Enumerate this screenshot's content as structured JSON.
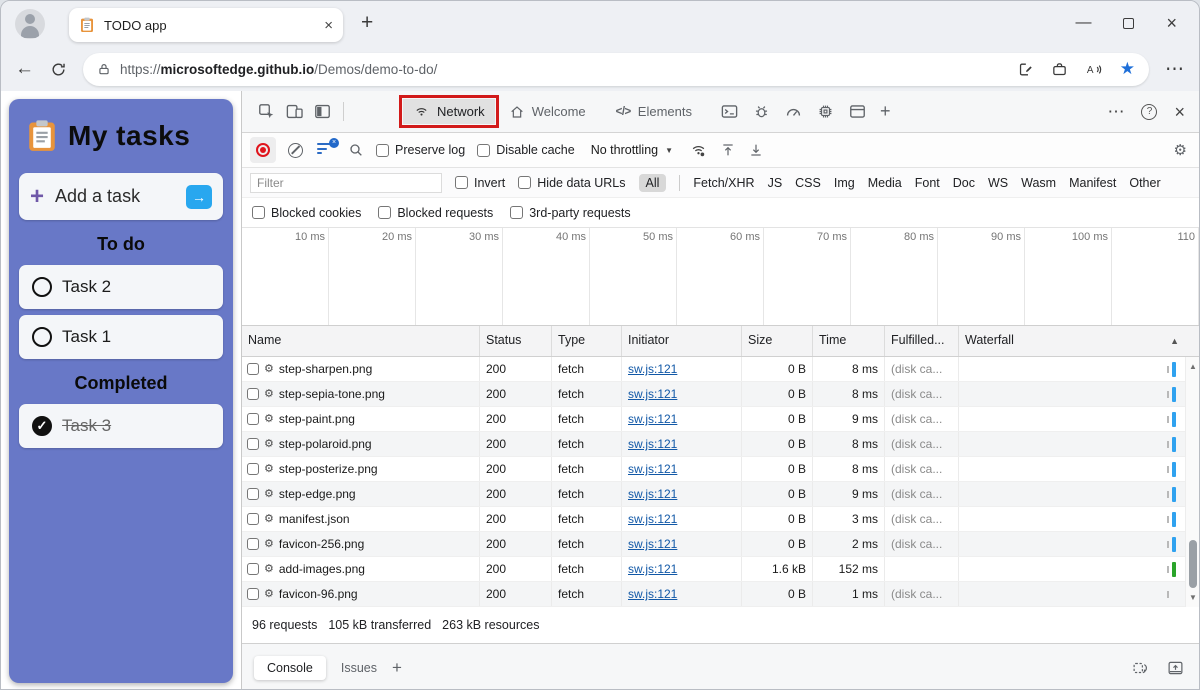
{
  "browser": {
    "tab_title": "TODO app",
    "url_scheme": "https://",
    "url_host": "microsoftedge.github.io",
    "url_path": "/Demos/demo-to-do/"
  },
  "todo": {
    "title": "My tasks",
    "add_label": "Add a task",
    "sections": [
      {
        "heading": "To do",
        "tasks": [
          {
            "label": "Task 2",
            "done": false
          },
          {
            "label": "Task 1",
            "done": false
          }
        ]
      },
      {
        "heading": "Completed",
        "tasks": [
          {
            "label": "Task 3",
            "done": true
          }
        ]
      }
    ]
  },
  "devtools": {
    "tabs": [
      {
        "label": "Network",
        "icon": "wifi-icon",
        "active": true,
        "highlighted": true
      },
      {
        "label": "Welcome",
        "icon": "home-icon",
        "active": false
      },
      {
        "label": "Elements",
        "icon": "code-icon",
        "active": false
      }
    ],
    "network_toolbar": {
      "preserve_log": "Preserve log",
      "disable_cache": "Disable cache",
      "throttling": "No throttling"
    },
    "filter_bar": {
      "placeholder": "Filter",
      "invert": "Invert",
      "hide_data_urls": "Hide data URLs",
      "selected_type": "All",
      "types": [
        "All",
        "Fetch/XHR",
        "JS",
        "CSS",
        "Img",
        "Media",
        "Font",
        "Doc",
        "WS",
        "Wasm",
        "Manifest",
        "Other"
      ]
    },
    "blocked_bar": [
      "Blocked cookies",
      "Blocked requests",
      "3rd-party requests"
    ],
    "timeline_labels": [
      "10 ms",
      "20 ms",
      "30 ms",
      "40 ms",
      "50 ms",
      "60 ms",
      "70 ms",
      "80 ms",
      "90 ms",
      "100 ms",
      "110"
    ],
    "table": {
      "columns": [
        "Name",
        "Status",
        "Type",
        "Initiator",
        "Size",
        "Time",
        "Fulfilled...",
        "Waterfall"
      ],
      "rows": [
        {
          "name": "step-sharpen.png",
          "status": "200",
          "type": "fetch",
          "initiator": "sw.js:121",
          "size": "0 B",
          "time": "8 ms",
          "fulfilled": "(disk ca...",
          "waterfall": "blue"
        },
        {
          "name": "step-sepia-tone.png",
          "status": "200",
          "type": "fetch",
          "initiator": "sw.js:121",
          "size": "0 B",
          "time": "8 ms",
          "fulfilled": "(disk ca...",
          "waterfall": "blue"
        },
        {
          "name": "step-paint.png",
          "status": "200",
          "type": "fetch",
          "initiator": "sw.js:121",
          "size": "0 B",
          "time": "9 ms",
          "fulfilled": "(disk ca...",
          "waterfall": "blue"
        },
        {
          "name": "step-polaroid.png",
          "status": "200",
          "type": "fetch",
          "initiator": "sw.js:121",
          "size": "0 B",
          "time": "8 ms",
          "fulfilled": "(disk ca...",
          "waterfall": "blue"
        },
        {
          "name": "step-posterize.png",
          "status": "200",
          "type": "fetch",
          "initiator": "sw.js:121",
          "size": "0 B",
          "time": "8 ms",
          "fulfilled": "(disk ca...",
          "waterfall": "blue"
        },
        {
          "name": "step-edge.png",
          "status": "200",
          "type": "fetch",
          "initiator": "sw.js:121",
          "size": "0 B",
          "time": "9 ms",
          "fulfilled": "(disk ca...",
          "waterfall": "blue"
        },
        {
          "name": "manifest.json",
          "status": "200",
          "type": "fetch",
          "initiator": "sw.js:121",
          "size": "0 B",
          "time": "3 ms",
          "fulfilled": "(disk ca...",
          "waterfall": "blue"
        },
        {
          "name": "favicon-256.png",
          "status": "200",
          "type": "fetch",
          "initiator": "sw.js:121",
          "size": "0 B",
          "time": "2 ms",
          "fulfilled": "(disk ca...",
          "waterfall": "blue"
        },
        {
          "name": "add-images.png",
          "status": "200",
          "type": "fetch",
          "initiator": "sw.js:121",
          "size": "1.6 kB",
          "time": "152 ms",
          "fulfilled": "",
          "waterfall": "green"
        },
        {
          "name": "favicon-96.png",
          "status": "200",
          "type": "fetch",
          "initiator": "sw.js:121",
          "size": "0 B",
          "time": "1 ms",
          "fulfilled": "(disk ca...",
          "waterfall": "none"
        }
      ]
    },
    "summary": [
      "96 requests",
      "105 kB transferred",
      "263 kB resources"
    ],
    "drawer_tabs": [
      "Console",
      "Issues"
    ]
  },
  "colors": {
    "annotation_red": "#d21a1a",
    "panel_purple": "#6878c7",
    "accent_blue": "#28a7ef",
    "record_red": "#e0141c",
    "link_blue": "#1158a7",
    "waterfall_blue": "#30a2ef",
    "waterfall_green": "#2aa42a",
    "favorite_star_blue": "#1e6fd9"
  }
}
